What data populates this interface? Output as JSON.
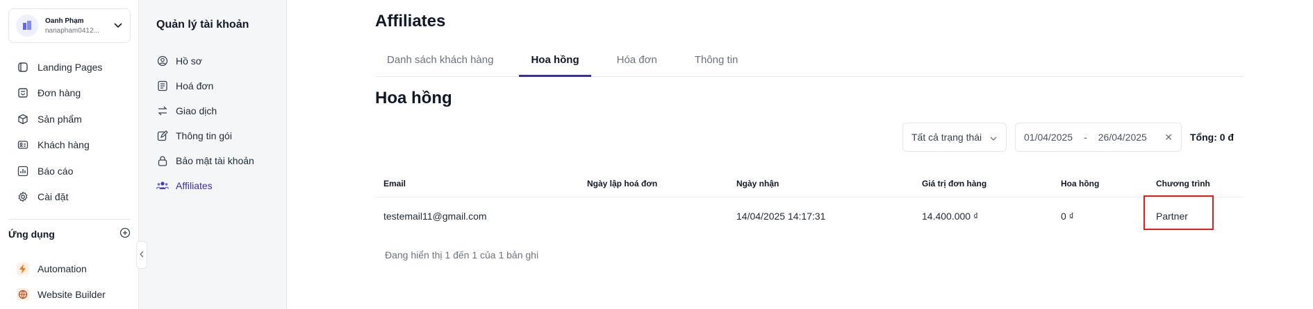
{
  "account": {
    "name": "Oanh Phạm",
    "email": "nanapham0412..."
  },
  "sidebar": {
    "items": [
      {
        "label": "Landing Pages",
        "icon": "landing-pages-icon"
      },
      {
        "label": "Đơn hàng",
        "icon": "orders-icon"
      },
      {
        "label": "Sản phẩm",
        "icon": "box-icon"
      },
      {
        "label": "Khách hàng",
        "icon": "contact-card-icon"
      },
      {
        "label": "Báo cáo",
        "icon": "chart-icon"
      },
      {
        "label": "Cài đặt",
        "icon": "gear-icon"
      }
    ],
    "apps_title": "Ứng dụng",
    "apps": [
      {
        "label": "Automation",
        "icon": "lightning-icon"
      },
      {
        "label": "Website Builder",
        "icon": "globe-icon"
      }
    ]
  },
  "subnav": {
    "title": "Quản lý tài khoản",
    "items": [
      {
        "label": "Hồ sơ",
        "icon": "user-circle-icon"
      },
      {
        "label": "Hoá đơn",
        "icon": "invoice-icon"
      },
      {
        "label": "Giao dịch",
        "icon": "transfer-icon"
      },
      {
        "label": "Thông tin gói",
        "icon": "edit-icon"
      },
      {
        "label": "Bảo mật tài khoản",
        "icon": "lock-icon"
      },
      {
        "label": "Affiliates",
        "icon": "users-icon",
        "active": true
      }
    ]
  },
  "main": {
    "title": "Affiliates",
    "tabs": [
      {
        "label": "Danh sách khách hàng"
      },
      {
        "label": "Hoa hồng",
        "active": true
      },
      {
        "label": "Hóa đơn"
      },
      {
        "label": "Thông tin"
      }
    ],
    "section_title": "Hoa hồng",
    "filters": {
      "status": "Tất cả trạng thái",
      "date_from": "01/04/2025",
      "date_to": "26/04/2025",
      "date_sep": "-",
      "total": "Tổng: 0 đ"
    },
    "table": {
      "headers": [
        "Email",
        "Ngày lập hoá đơn",
        "Ngày nhận",
        "Giá trị đơn hàng",
        "Hoa hồng",
        "Chương trình"
      ],
      "rows": [
        [
          "testemail11@gmail.com",
          "",
          "14/04/2025 14:17:31",
          "14.400.000 ₫",
          "0 ₫",
          "Partner"
        ]
      ]
    },
    "footer": "Đang hiển thị 1 đến 1 của 1 bản ghi"
  },
  "colors": {
    "accent": "#3730a3",
    "highlight": "#e11d1d"
  }
}
